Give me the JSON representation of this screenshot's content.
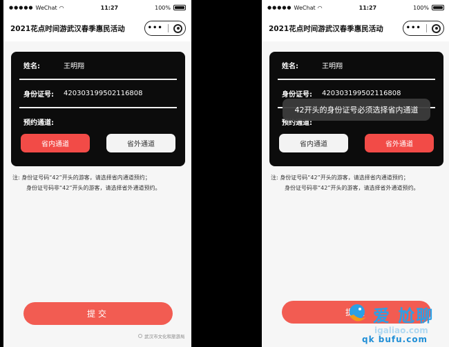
{
  "screens": [
    {
      "status": {
        "carrier": "WeChat",
        "time": "11:27",
        "battery": "100%"
      },
      "nav_title": "2021花点时间游武汉春季惠民活动",
      "form": {
        "name_label": "姓名:",
        "name_value": "王明翔",
        "id_label": "身份证号:",
        "id_value": "420303199502116808",
        "channel_label": "预约通道:",
        "channels": [
          {
            "label": "省内通道",
            "selected": true
          },
          {
            "label": "省外通道",
            "selected": false
          }
        ]
      },
      "note": {
        "prefix": "注:",
        "line1": "身份证号码“42”开头的游客，请选择省内通道预约；",
        "line2": "身份证号码非“42”开头的游客，请选择省外通道预约。"
      },
      "submit_label": "提交",
      "footer_org": "武汉市文化和旅游局"
    },
    {
      "status": {
        "carrier": "WeChat",
        "time": "11:27",
        "battery": "100%"
      },
      "nav_title": "2021花点时间游武汉春季惠民活动",
      "form": {
        "name_label": "姓名:",
        "name_value": "王明翔",
        "id_label": "身份证号:",
        "id_value": "420303199502116808",
        "channel_label": "预约通道:",
        "channels": [
          {
            "label": "省内通道",
            "selected": false
          },
          {
            "label": "省外通道",
            "selected": true
          }
        ]
      },
      "toast": "42开头的身份证号必须选择省内通道",
      "note": {
        "prefix": "注:",
        "line1": "身份证号码“42”开头的游客，请选择省内通道预约；",
        "line2": "身份证号码非“42”开头的游客，请选择省外通道预约。"
      },
      "submit_label": "提交"
    }
  ],
  "watermark": {
    "top": "爱 尬聊",
    "site": "igaliao.com",
    "bottom": "qk bufu.com"
  },
  "colors": {
    "accent": "#f24b47",
    "submit": "#f25c52",
    "card": "#0c0c0c",
    "toast": "#3c3c3c"
  }
}
